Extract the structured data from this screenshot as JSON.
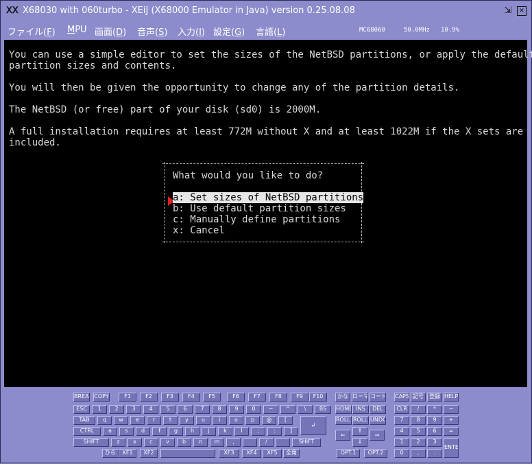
{
  "window": {
    "title": "X68030 with 060turbo - XEiJ (X68000 Emulator in Java) version 0.25.08.08",
    "app_icon": "ⅩⅩ",
    "restore_glyph": "⇲",
    "maximize_glyph": "▢",
    "close_glyph": "✕"
  },
  "menubar": {
    "items": [
      {
        "label": "ファイル(",
        "key": "F",
        "end": ")"
      },
      {
        "label": "",
        "key": "M",
        "end": "PU"
      },
      {
        "label": "画面(",
        "key": "D",
        "end": ")"
      },
      {
        "label": "音声(",
        "key": "S",
        "end": ")"
      },
      {
        "label": "入力(",
        "key": "I",
        "end": ")"
      },
      {
        "label": "設定(",
        "key": "G",
        "end": ")"
      },
      {
        "label": "言語(",
        "key": "L",
        "end": ")"
      }
    ],
    "cpu": "MC68060",
    "clock": "50.0MHz",
    "load": "10.9%"
  },
  "screen": {
    "lines": [
      "You can use a simple editor to set the sizes of the NetBSD partitions, or apply the default",
      "partition sizes and contents.",
      "You will then be given the opportunity to change any of the partition details.",
      "The NetBSD (or free) part of your disk (sd0) is 2000M.",
      "A full installation requires at least 772M without X and at least 1022M if the X sets are",
      "included."
    ],
    "dialog": {
      "prompt": "What would you like to do?",
      "options": [
        "a: Set sizes of NetBSD partitions",
        "b: Use default partition sizes",
        "c: Manually define partitions",
        "x: Cancel"
      ],
      "selected": 0
    }
  },
  "keyboard": {
    "fn_row": [
      "BREAK",
      "COPY",
      "F1",
      "F2",
      "F3",
      "F4",
      "F5",
      "F6",
      "F7",
      "F8",
      "F9",
      "F10",
      "かな",
      "ローマ",
      "コード",
      "CAPS",
      "記号",
      "登録",
      "HELP"
    ],
    "row1": [
      "ESC",
      "1",
      "2",
      "3",
      "4",
      "5",
      "6",
      "7",
      "8",
      "9",
      "0",
      "−",
      "^",
      "\\",
      "BS"
    ],
    "row2": [
      "TAB",
      "q",
      "w",
      "e",
      "r",
      "t",
      "y",
      "u",
      "i",
      "o",
      "p",
      "@",
      "["
    ],
    "row3": [
      "CTRL",
      "a",
      "s",
      "d",
      "f",
      "g",
      "h",
      "j",
      "k",
      "l",
      ";",
      ":",
      "]"
    ],
    "row4": [
      "SHIFT",
      "z",
      "x",
      "c",
      "v",
      "b",
      "n",
      "m",
      ",",
      ".",
      "/",
      "",
      "SHIFT"
    ],
    "row5": [
      "ひら",
      "XF1",
      "XF2",
      "",
      "XF3",
      "XF4",
      "XF5",
      "全角"
    ],
    "return_key": "↲",
    "edit_keys": [
      "HOME",
      "INS",
      "DEL",
      "ROLL UP",
      "ROLL DOWN",
      "UNDO",
      "⇐",
      "⇑",
      "⇒",
      "⇓",
      "OPT.1",
      "OPT.2"
    ],
    "num_keys": [
      "CLR",
      "/",
      "*",
      "−",
      "7",
      "8",
      "9",
      "+",
      "4",
      "5",
      "6",
      "=",
      "1",
      "2",
      "3",
      "ENTER",
      "0",
      ",",
      "."
    ]
  }
}
